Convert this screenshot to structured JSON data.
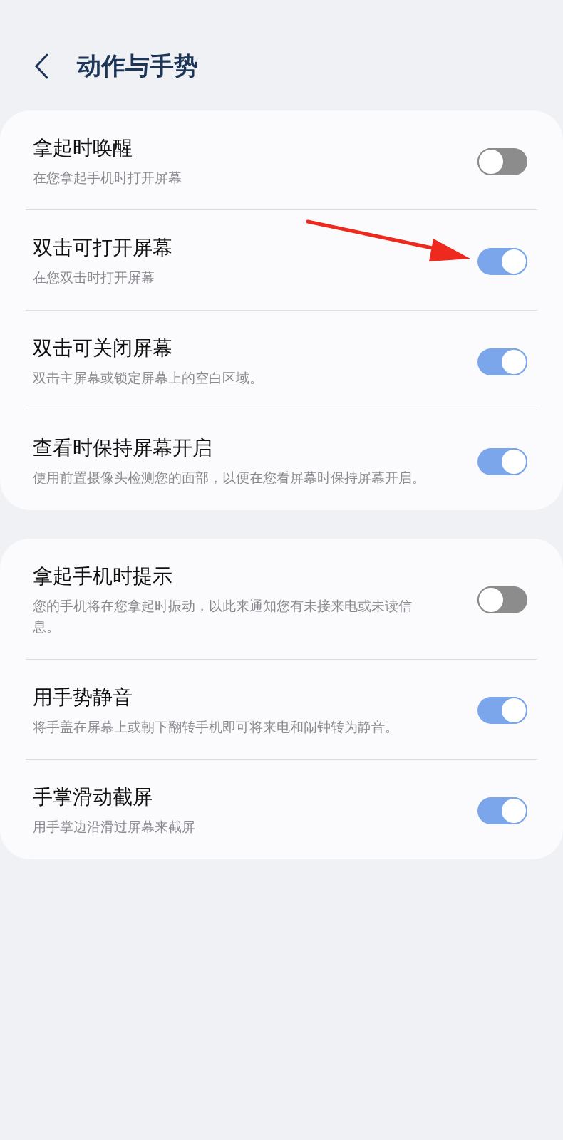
{
  "header": {
    "title": "动作与手势"
  },
  "groups": [
    {
      "items": [
        {
          "title": "拿起时唤醒",
          "subtitle": "在您拿起手机时打开屏幕",
          "on": false
        },
        {
          "title": "双击可打开屏幕",
          "subtitle": "在您双击时打开屏幕",
          "on": true
        },
        {
          "title": "双击可关闭屏幕",
          "subtitle": "双击主屏幕或锁定屏幕上的空白区域。",
          "on": true
        },
        {
          "title": "查看时保持屏幕开启",
          "subtitle": "使用前置摄像头检测您的面部，以便在您看屏幕时保持屏幕开启。",
          "on": true
        }
      ]
    },
    {
      "items": [
        {
          "title": "拿起手机时提示",
          "subtitle": "您的手机将在您拿起时振动，以此来通知您有未接来电或未读信息。",
          "on": false
        },
        {
          "title": "用手势静音",
          "subtitle": "将手盖在屏幕上或朝下翻转手机即可将来电和闹钟转为静音。",
          "on": true
        },
        {
          "title": "手掌滑动截屏",
          "subtitle": "用手掌边沿滑过屏幕来截屏",
          "on": true
        }
      ]
    }
  ]
}
